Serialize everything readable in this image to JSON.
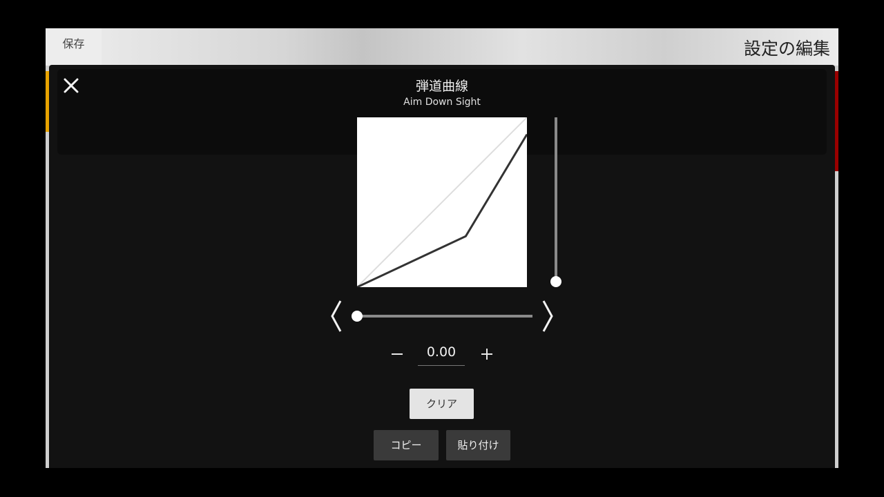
{
  "header": {
    "save_label": "保存",
    "page_title": "設定の編集"
  },
  "modal": {
    "title": "弾道曲線",
    "subtitle": "Aim Down Sight",
    "value": "0.00",
    "clear_label": "クリア",
    "copy_label": "コピー",
    "paste_label": "貼り付け"
  },
  "curve": {
    "reference_line": [
      [
        0,
        0
      ],
      [
        1,
        1
      ]
    ],
    "response_curve": [
      [
        0,
        0
      ],
      [
        0.64,
        0.3
      ],
      [
        1,
        0.9
      ]
    ],
    "vertical_slider": 0.0,
    "horizontal_slider": 0.0
  },
  "colors": {
    "modal_bg": "#121212",
    "curve_line": "#333333",
    "reference_line": "#dddddd",
    "accent_left": "#e8a300",
    "accent_right": "#9a0000"
  }
}
